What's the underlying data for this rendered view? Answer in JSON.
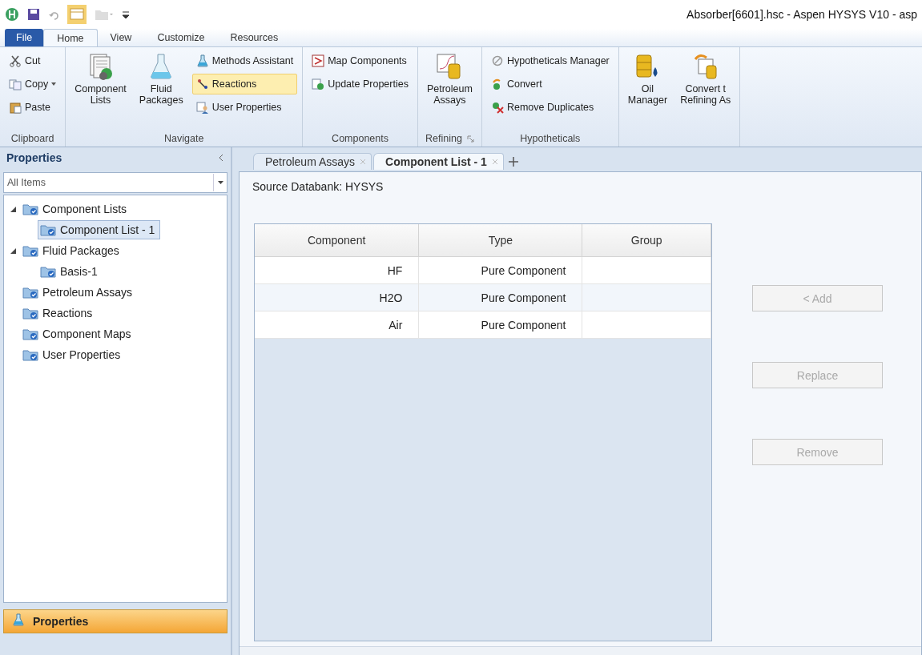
{
  "window": {
    "title": "Absorber[6601].hsc - Aspen HYSYS V10 - asp"
  },
  "ribbon": {
    "tabs": [
      {
        "label": "File",
        "kind": "file",
        "selected": false
      },
      {
        "label": "Home",
        "kind": "tab",
        "selected": true
      },
      {
        "label": "View",
        "kind": "tab",
        "selected": false
      },
      {
        "label": "Customize",
        "kind": "tab",
        "selected": false
      },
      {
        "label": "Resources",
        "kind": "tab",
        "selected": false
      }
    ],
    "groups": [
      {
        "label": "Clipboard",
        "items": [
          {
            "label": "Cut",
            "kind": "small",
            "highlighted": false
          },
          {
            "label": "Copy",
            "kind": "small",
            "highlighted": false,
            "dropdown": true
          },
          {
            "label": "Paste",
            "kind": "small",
            "highlighted": false
          }
        ]
      },
      {
        "label": "Navigate",
        "items": [
          {
            "label": "Component\nLists",
            "kind": "large",
            "highlighted": false
          },
          {
            "label": "Fluid\nPackages",
            "kind": "large",
            "highlighted": false
          },
          {
            "label": "Methods Assistant",
            "kind": "small",
            "highlighted": false
          },
          {
            "label": "Reactions",
            "kind": "small",
            "highlighted": true
          },
          {
            "label": "User Properties",
            "kind": "small",
            "highlighted": false
          }
        ]
      },
      {
        "label": "Components",
        "items": [
          {
            "label": "Map Components",
            "kind": "small",
            "highlighted": false
          },
          {
            "label": "Update Properties",
            "kind": "small",
            "highlighted": false
          }
        ]
      },
      {
        "label": "Refining",
        "launcher": true,
        "items": [
          {
            "label": "Petroleum\nAssays",
            "kind": "large",
            "highlighted": false
          }
        ]
      },
      {
        "label": "Hypotheticals",
        "items": [
          {
            "label": "Hypotheticals Manager",
            "kind": "small",
            "highlighted": false
          },
          {
            "label": "Convert",
            "kind": "small",
            "highlighted": false
          },
          {
            "label": "Remove Duplicates",
            "kind": "small",
            "highlighted": false
          }
        ]
      },
      {
        "items": [
          {
            "label": "Oil\nManager",
            "kind": "large",
            "highlighted": false
          },
          {
            "label": "Convert t\nRefining As",
            "kind": "large",
            "highlighted": false
          }
        ]
      }
    ]
  },
  "sidebar": {
    "title": "Properties",
    "filter": {
      "value": "All Items"
    },
    "tree": [
      {
        "label": "Component Lists",
        "expanded": true,
        "selected": false,
        "children": [
          {
            "label": "Component List - 1",
            "selected": true
          }
        ]
      },
      {
        "label": "Fluid Packages",
        "expanded": true,
        "selected": false,
        "children": [
          {
            "label": "Basis-1",
            "selected": false
          }
        ]
      },
      {
        "label": "Petroleum Assays",
        "selected": false
      },
      {
        "label": "Reactions",
        "selected": false
      },
      {
        "label": "Component Maps",
        "selected": false
      },
      {
        "label": "User Properties",
        "selected": false
      }
    ],
    "nav_buttons": [
      {
        "label": "Properties",
        "selected": true
      }
    ]
  },
  "document_tabs": [
    {
      "label": "Petroleum Assays",
      "selected": false
    },
    {
      "label": "Component List - 1",
      "selected": true
    }
  ],
  "content": {
    "source_databank": "Source Databank: HYSYS",
    "table": {
      "columns": [
        "Component",
        "Type",
        "Group"
      ],
      "rows": [
        [
          "HF",
          "Pure Component"
        ],
        [
          "H2O",
          "Pure Component"
        ],
        [
          "Air",
          "Pure Component"
        ]
      ]
    },
    "buttons": [
      {
        "label": "< Add",
        "disabled": true
      },
      {
        "label": "Replace",
        "disabled": true
      },
      {
        "label": "Remove",
        "disabled": true
      }
    ]
  }
}
